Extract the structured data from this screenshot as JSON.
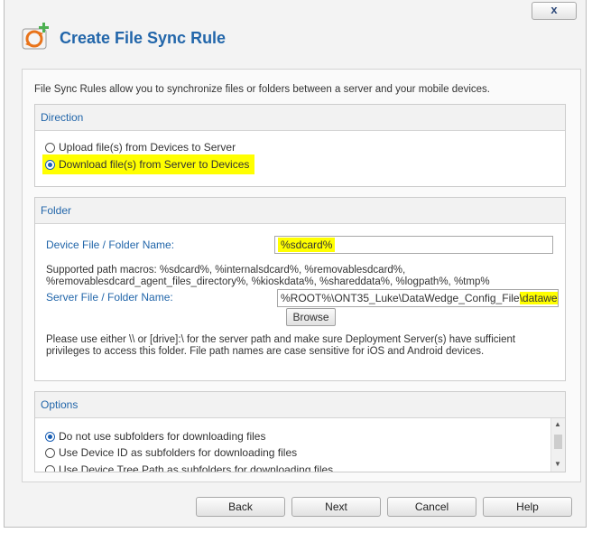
{
  "window": {
    "close_label": "x",
    "title": "Create File Sync Rule"
  },
  "intro": "File Sync Rules allow you to synchronize files or folders between a server and your mobile devices.",
  "direction": {
    "header": "Direction",
    "options": [
      {
        "label": "Upload file(s) from Devices to Server",
        "checked": false
      },
      {
        "label": "Download file(s) from Server to Devices",
        "checked": true
      }
    ]
  },
  "folder": {
    "header": "Folder",
    "device_label": "Device File / Folder Name:",
    "device_value": "%sdcard%",
    "macros_line1": "Supported path macros: %sdcard%, %internalsdcard%, %removablesdcard%,",
    "macros_line2": "%removablesdcard_agent_files_directory%, %kioskdata%, %shareddata%, %logpath%, %tmp%",
    "server_label": "Server File / Folder Name:",
    "server_value_prefix": "%ROOT%\\ONT35_Luke\\DataWedge_Config_File",
    "server_value_highlight": "\\datawedge.db",
    "browse_label": "Browse",
    "note": "Please use either \\\\ or [drive]:\\ for the server path and make sure Deployment Server(s) have sufficient privileges to access this folder. File path names are case sensitive for iOS and Android devices."
  },
  "options": {
    "header": "Options",
    "items": [
      {
        "label": "Do not use subfolders for downloading files",
        "checked": true
      },
      {
        "label": "Use Device ID as subfolders for downloading files",
        "checked": false
      },
      {
        "label": "Use Device Tree Path as subfolders for downloading files",
        "checked": false
      }
    ]
  },
  "footer": {
    "back": "Back",
    "next": "Next",
    "cancel": "Cancel",
    "help": "Help"
  },
  "colors": {
    "accent": "#2266aa",
    "highlight": "#ffff00",
    "icon_orange": "#e8731a",
    "icon_green": "#4caf50"
  }
}
